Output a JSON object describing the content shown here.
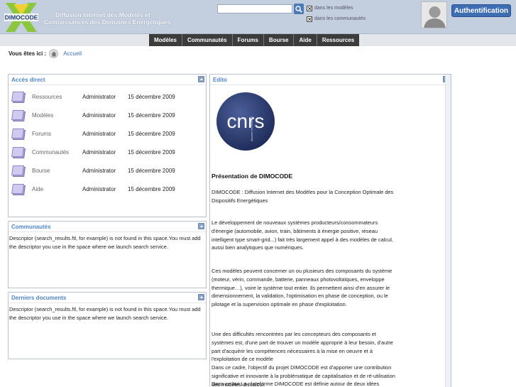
{
  "header": {
    "logo_text": "DIMOCODE",
    "tagline_line1": "Diffusion  Internet des  Modèles et",
    "tagline_line2": "Connaissances des Domaines  Energétiques",
    "search": {
      "value": "",
      "placeholder": ""
    },
    "scope_models": "dans les modèles",
    "scope_communities": "dans les communautés",
    "auth_button": "Authentification"
  },
  "nav": {
    "items": [
      {
        "label": "Modèles"
      },
      {
        "label": "Communautés"
      },
      {
        "label": "Forums"
      },
      {
        "label": "Bourse"
      },
      {
        "label": "Aide"
      },
      {
        "label": "Ressources"
      }
    ]
  },
  "breadcrumb": {
    "label": "Vous êtes ici :",
    "home": "Accueil"
  },
  "acces_direct": {
    "title": "Accès direct",
    "rows": [
      {
        "name": "Ressources",
        "author": "Administrator",
        "date": "15 décembre 2009"
      },
      {
        "name": "Modèles",
        "author": "Administrator",
        "date": "15 décembre 2009"
      },
      {
        "name": "Forums",
        "author": "Administrator",
        "date": "15 décembre 2009"
      },
      {
        "name": "Communautés",
        "author": "Administrator",
        "date": "15 décembre 2009"
      },
      {
        "name": "Bourse",
        "author": "Administrator",
        "date": "15 décembre 2009"
      },
      {
        "name": "Aide",
        "author": "Administrator",
        "date": "15 décembre 2009"
      }
    ]
  },
  "communautes": {
    "title": "Communautés",
    "message": "Descriptor (search_results.ftl, for example) is not found in this space.You must add the descriptor you use in the space where we launch search service."
  },
  "derniers_documents": {
    "title": "Derniers documents",
    "message": "Descriptor (search_results.ftl, for example) is not found in this space.You must add the descriptor you use in the space where we launch search service."
  },
  "edito": {
    "title": "Edito",
    "logo_text": "cnrs",
    "logo_subtext": "dépasser les frontières",
    "heading": "Présentation de DIMOCODE",
    "p1": "DIMOCODE : Diffusion Internet des Modèles pour la Conception Optimale des Dispositifs Energétiques",
    "p2": "Le développement de nouveaux systèmes producteurs/consommateurs d'énergie (automobile, avion, train, bâtiments à énergie positive, réseau intelligent type smart-grid...) fait très largement appel à des modèles de calcul, aussi bien analytiques que numériques.",
    "p3": "Ces modèles peuvent concerner un ou plusieurs des composants du système (moteur, vérin, commande, batterie, panneaux photovoltaïques, enveloppe thermique…), voire le système tout entier. Ils permettent ainsi d'en assurer le dimensionnement, la validation, l'optimisation en phase de conception, ou le pilotage et la supervision optimale en phase d'exploitation.",
    "p4": "Une des difficultés rencontrées par les concepteurs des composants et systèmes est, d'une part de trouver un modèle approprié à leur besoin, d'autre part d'acquérir les compétences nécessaires à la mise en oeuvre et à l'exploitation de ce modèle",
    "p5": "Dans ce cadre, l'objectif du projet DIMOCODE est d'apporter une contribution significative et innovante à la problématique de capitalisation et de ré-utilisation des modèles de calcul.",
    "p6": "Dans ce but La plateforme DIMOCODE est définie autour de deux idées complémentaires :"
  },
  "colors": {
    "header_bg": "#c3cede",
    "accent": "#4f86c6",
    "nav_bg": "#3c3c3c",
    "auth_bg": "#3d6db2"
  }
}
